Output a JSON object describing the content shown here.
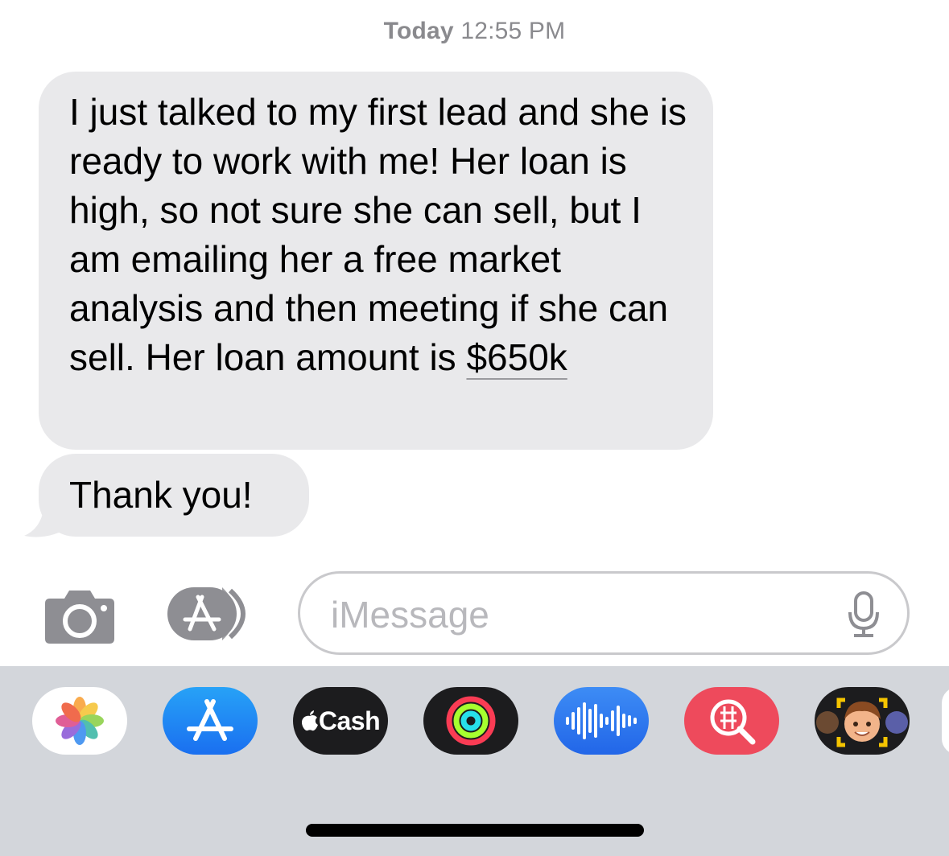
{
  "header": {
    "day": "Today",
    "time": "12:55 PM"
  },
  "messages": [
    {
      "text": "I just talked to my first lead and she is ready to work with me! Her loan is high, so not sure she can sell, but I am emailing her a free market analysis and then meeting if she can sell. Her loan amount is",
      "amount": "$650k"
    },
    {
      "text": "Thank you!"
    }
  ],
  "input": {
    "placeholder": "iMessage"
  },
  "app_drawer": {
    "cash_label": "Cash",
    "apps": [
      "photos-icon",
      "app-store-icon",
      "apple-cash-icon",
      "fitness-rings-icon",
      "audio-message-icon",
      "image-search-icon",
      "memoji-icon"
    ]
  },
  "colors": {
    "received_bubble": "#e9e9eb",
    "drawer_background": "#d3d6db",
    "placeholder_text": "#b8b8bc"
  }
}
